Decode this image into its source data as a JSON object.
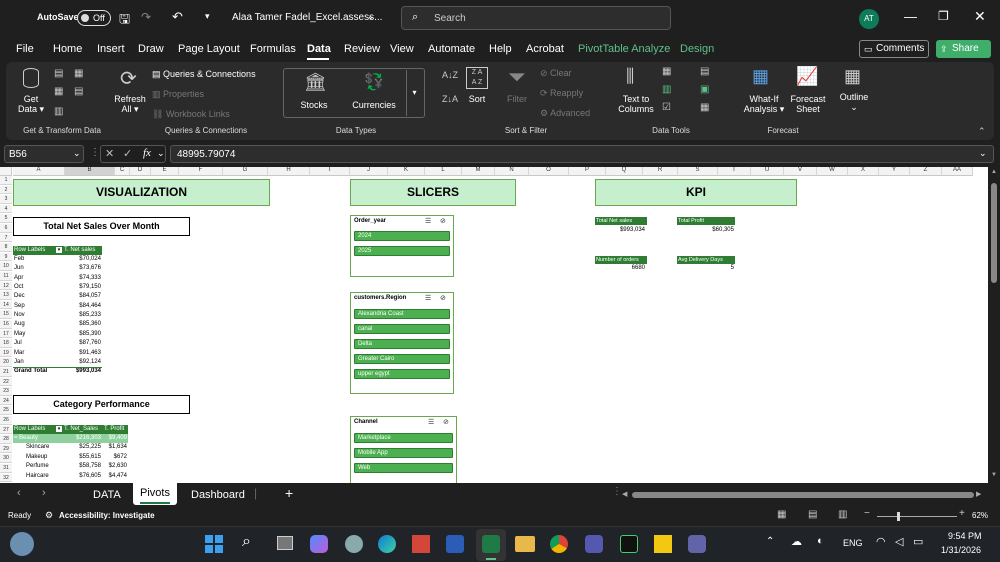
{
  "titlebar": {
    "autosave_label": "AutoSave",
    "autosave_state": "Off",
    "filename": "Alaa Tamer Fadel_Excel.assess...",
    "search_placeholder": "Search",
    "avatar_initials": "AT"
  },
  "menu": {
    "items": [
      "File",
      "Home",
      "Insert",
      "Draw",
      "Page Layout",
      "Formulas",
      "Data",
      "Review",
      "View",
      "Automate",
      "Help",
      "Acrobat",
      "PivotTable Analyze",
      "Design"
    ],
    "active": "Data",
    "comments_label": "Comments",
    "share_label": "Share"
  },
  "ribbon": {
    "get_data": "Get Data",
    "refresh_all": "Refresh All",
    "queries_connections": "Queries & Connections",
    "properties": "Properties",
    "workbook_links": "Workbook Links",
    "stocks": "Stocks",
    "currencies": "Currencies",
    "sort": "Sort",
    "filter": "Filter",
    "clear": "Clear",
    "reapply": "Reapply",
    "advanced": "Advanced",
    "text_to_columns": "Text to Columns",
    "what_if": "What-If Analysis",
    "forecast_sheet": "Forecast Sheet",
    "outline": "Outline",
    "groups": {
      "get_transform": "Get & Transform Data",
      "queries": "Queries & Connections",
      "data_types": "Data Types",
      "sort_filter": "Sort & Filter",
      "data_tools": "Data Tools",
      "forecast": "Forecast"
    }
  },
  "formula": {
    "name_box": "B56",
    "fx": "fx",
    "value": "48995.79074"
  },
  "columns": [
    "A",
    "B",
    "C",
    "D",
    "E",
    "F",
    "G",
    "H",
    "I",
    "J",
    "K",
    "L",
    "M",
    "N",
    "O",
    "P",
    "Q",
    "R",
    "S",
    "T",
    "U",
    "V",
    "W",
    "X",
    "Y",
    "Z",
    "AA"
  ],
  "rows": [
    "1",
    "2",
    "3",
    "4",
    "5",
    "6",
    "7",
    "8",
    "9",
    "10",
    "11",
    "12",
    "13",
    "14",
    "15",
    "16",
    "17",
    "18",
    "19",
    "20",
    "21",
    "22",
    "23",
    "24",
    "25",
    "26",
    "27",
    "28",
    "29",
    "30",
    "31",
    "32"
  ],
  "sheet": {
    "visualization": "VISUALIZATION",
    "slicers": "SLICERS",
    "kpi": "KPI",
    "net_sales_title": "Total Net Sales Over Month",
    "category_title": "Category Performance",
    "pivot1": {
      "col1": "Row Labels",
      "col2": "T. Net sales",
      "rows": [
        {
          "label": "Feb",
          "value": "$70,024"
        },
        {
          "label": "Jun",
          "value": "$73,676"
        },
        {
          "label": "Apr",
          "value": "$74,333"
        },
        {
          "label": "Oct",
          "value": "$79,150"
        },
        {
          "label": "Dec",
          "value": "$84,057"
        },
        {
          "label": "Sep",
          "value": "$84,464"
        },
        {
          "label": "Nov",
          "value": "$85,233"
        },
        {
          "label": "Aug",
          "value": "$85,360"
        },
        {
          "label": "May",
          "value": "$85,390"
        },
        {
          "label": "Jul",
          "value": "$87,760"
        },
        {
          "label": "Mar",
          "value": "$91,463"
        },
        {
          "label": "Jan",
          "value": "$92,124"
        }
      ],
      "total_label": "Grand Total",
      "total_value": "$993,034"
    },
    "pivot2": {
      "col1": "Row Labels",
      "col2": "T. Net_Sales",
      "col3": "T. Profit",
      "rows": [
        {
          "label": "= Beauty",
          "sales": "$216,303",
          "profit": "$9,409",
          "group": true
        },
        {
          "label": "Skincare",
          "sales": "$25,225",
          "profit": "$1,634",
          "group": false
        },
        {
          "label": "Makeup",
          "sales": "$55,615",
          "profit": "$672",
          "group": false
        },
        {
          "label": "Perfume",
          "sales": "$58,758",
          "profit": "$2,630",
          "group": false
        },
        {
          "label": "Haircare",
          "sales": "$76,605",
          "profit": "$4,474",
          "group": false
        }
      ]
    },
    "slicer_order_year": {
      "title": "Order_year",
      "items": [
        "2024",
        "2025"
      ]
    },
    "slicer_region": {
      "title": "customers.Region",
      "items": [
        "Alexandria Coast",
        "canal",
        "Delta",
        "Greater Cairo",
        "upper egypt"
      ]
    },
    "slicer_channel": {
      "title": "Channel",
      "items": [
        "Marketplace",
        "Mobile App",
        "Web"
      ]
    },
    "kpis": {
      "total_net_sales_label": "Total Net sales",
      "total_net_sales_value": "$993,034",
      "total_profit_label": "Total Profit",
      "total_profit_value": "$60,305",
      "orders_label": "Number of orders",
      "orders_value": "6680",
      "delivery_label": "Avg Delivery Days",
      "delivery_value": "5"
    }
  },
  "tabs": [
    "DATA",
    "Pivots",
    "Dashboard"
  ],
  "active_tab": "Pivots",
  "status": {
    "ready": "Ready",
    "accessibility": "Accessibility: Investigate",
    "zoom": "62%"
  },
  "taskbar": {
    "lang": "ENG",
    "time": "9:54 PM",
    "date": "1/31/2026"
  }
}
